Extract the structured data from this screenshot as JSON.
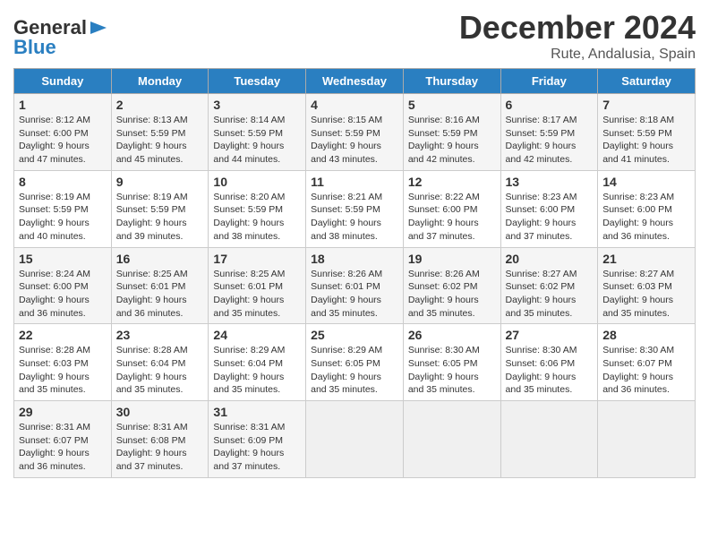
{
  "header": {
    "logo_line1": "General",
    "logo_line2": "Blue",
    "month": "December 2024",
    "location": "Rute, Andalusia, Spain"
  },
  "weekdays": [
    "Sunday",
    "Monday",
    "Tuesday",
    "Wednesday",
    "Thursday",
    "Friday",
    "Saturday"
  ],
  "weeks": [
    [
      {
        "day": "1",
        "sunrise": "Sunrise: 8:12 AM",
        "sunset": "Sunset: 6:00 PM",
        "daylight": "Daylight: 9 hours and 47 minutes."
      },
      {
        "day": "2",
        "sunrise": "Sunrise: 8:13 AM",
        "sunset": "Sunset: 5:59 PM",
        "daylight": "Daylight: 9 hours and 45 minutes."
      },
      {
        "day": "3",
        "sunrise": "Sunrise: 8:14 AM",
        "sunset": "Sunset: 5:59 PM",
        "daylight": "Daylight: 9 hours and 44 minutes."
      },
      {
        "day": "4",
        "sunrise": "Sunrise: 8:15 AM",
        "sunset": "Sunset: 5:59 PM",
        "daylight": "Daylight: 9 hours and 43 minutes."
      },
      {
        "day": "5",
        "sunrise": "Sunrise: 8:16 AM",
        "sunset": "Sunset: 5:59 PM",
        "daylight": "Daylight: 9 hours and 42 minutes."
      },
      {
        "day": "6",
        "sunrise": "Sunrise: 8:17 AM",
        "sunset": "Sunset: 5:59 PM",
        "daylight": "Daylight: 9 hours and 42 minutes."
      },
      {
        "day": "7",
        "sunrise": "Sunrise: 8:18 AM",
        "sunset": "Sunset: 5:59 PM",
        "daylight": "Daylight: 9 hours and 41 minutes."
      }
    ],
    [
      {
        "day": "8",
        "sunrise": "Sunrise: 8:19 AM",
        "sunset": "Sunset: 5:59 PM",
        "daylight": "Daylight: 9 hours and 40 minutes."
      },
      {
        "day": "9",
        "sunrise": "Sunrise: 8:19 AM",
        "sunset": "Sunset: 5:59 PM",
        "daylight": "Daylight: 9 hours and 39 minutes."
      },
      {
        "day": "10",
        "sunrise": "Sunrise: 8:20 AM",
        "sunset": "Sunset: 5:59 PM",
        "daylight": "Daylight: 9 hours and 38 minutes."
      },
      {
        "day": "11",
        "sunrise": "Sunrise: 8:21 AM",
        "sunset": "Sunset: 5:59 PM",
        "daylight": "Daylight: 9 hours and 38 minutes."
      },
      {
        "day": "12",
        "sunrise": "Sunrise: 8:22 AM",
        "sunset": "Sunset: 6:00 PM",
        "daylight": "Daylight: 9 hours and 37 minutes."
      },
      {
        "day": "13",
        "sunrise": "Sunrise: 8:23 AM",
        "sunset": "Sunset: 6:00 PM",
        "daylight": "Daylight: 9 hours and 37 minutes."
      },
      {
        "day": "14",
        "sunrise": "Sunrise: 8:23 AM",
        "sunset": "Sunset: 6:00 PM",
        "daylight": "Daylight: 9 hours and 36 minutes."
      }
    ],
    [
      {
        "day": "15",
        "sunrise": "Sunrise: 8:24 AM",
        "sunset": "Sunset: 6:00 PM",
        "daylight": "Daylight: 9 hours and 36 minutes."
      },
      {
        "day": "16",
        "sunrise": "Sunrise: 8:25 AM",
        "sunset": "Sunset: 6:01 PM",
        "daylight": "Daylight: 9 hours and 36 minutes."
      },
      {
        "day": "17",
        "sunrise": "Sunrise: 8:25 AM",
        "sunset": "Sunset: 6:01 PM",
        "daylight": "Daylight: 9 hours and 35 minutes."
      },
      {
        "day": "18",
        "sunrise": "Sunrise: 8:26 AM",
        "sunset": "Sunset: 6:01 PM",
        "daylight": "Daylight: 9 hours and 35 minutes."
      },
      {
        "day": "19",
        "sunrise": "Sunrise: 8:26 AM",
        "sunset": "Sunset: 6:02 PM",
        "daylight": "Daylight: 9 hours and 35 minutes."
      },
      {
        "day": "20",
        "sunrise": "Sunrise: 8:27 AM",
        "sunset": "Sunset: 6:02 PM",
        "daylight": "Daylight: 9 hours and 35 minutes."
      },
      {
        "day": "21",
        "sunrise": "Sunrise: 8:27 AM",
        "sunset": "Sunset: 6:03 PM",
        "daylight": "Daylight: 9 hours and 35 minutes."
      }
    ],
    [
      {
        "day": "22",
        "sunrise": "Sunrise: 8:28 AM",
        "sunset": "Sunset: 6:03 PM",
        "daylight": "Daylight: 9 hours and 35 minutes."
      },
      {
        "day": "23",
        "sunrise": "Sunrise: 8:28 AM",
        "sunset": "Sunset: 6:04 PM",
        "daylight": "Daylight: 9 hours and 35 minutes."
      },
      {
        "day": "24",
        "sunrise": "Sunrise: 8:29 AM",
        "sunset": "Sunset: 6:04 PM",
        "daylight": "Daylight: 9 hours and 35 minutes."
      },
      {
        "day": "25",
        "sunrise": "Sunrise: 8:29 AM",
        "sunset": "Sunset: 6:05 PM",
        "daylight": "Daylight: 9 hours and 35 minutes."
      },
      {
        "day": "26",
        "sunrise": "Sunrise: 8:30 AM",
        "sunset": "Sunset: 6:05 PM",
        "daylight": "Daylight: 9 hours and 35 minutes."
      },
      {
        "day": "27",
        "sunrise": "Sunrise: 8:30 AM",
        "sunset": "Sunset: 6:06 PM",
        "daylight": "Daylight: 9 hours and 35 minutes."
      },
      {
        "day": "28",
        "sunrise": "Sunrise: 8:30 AM",
        "sunset": "Sunset: 6:07 PM",
        "daylight": "Daylight: 9 hours and 36 minutes."
      }
    ],
    [
      {
        "day": "29",
        "sunrise": "Sunrise: 8:31 AM",
        "sunset": "Sunset: 6:07 PM",
        "daylight": "Daylight: 9 hours and 36 minutes."
      },
      {
        "day": "30",
        "sunrise": "Sunrise: 8:31 AM",
        "sunset": "Sunset: 6:08 PM",
        "daylight": "Daylight: 9 hours and 37 minutes."
      },
      {
        "day": "31",
        "sunrise": "Sunrise: 8:31 AM",
        "sunset": "Sunset: 6:09 PM",
        "daylight": "Daylight: 9 hours and 37 minutes."
      },
      null,
      null,
      null,
      null
    ]
  ]
}
